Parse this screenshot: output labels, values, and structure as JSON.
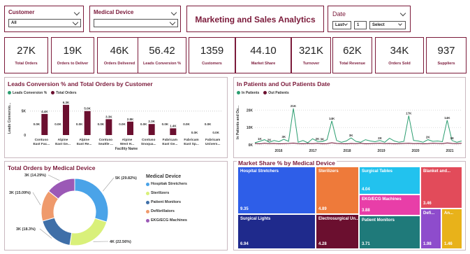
{
  "filters": {
    "customer": {
      "label": "Customer",
      "value": "All"
    },
    "device": {
      "label": "Medical Device",
      "value": ""
    },
    "title": "Marketing and Sales Analytics",
    "date": {
      "label": "Date",
      "mode": "Last",
      "count": "1",
      "unit": "Select"
    }
  },
  "kpis": [
    {
      "value": "27K",
      "label": "Total Orders"
    },
    {
      "value": "19K",
      "label": "Orders to Deliver"
    },
    {
      "value": "46K",
      "label": "Orders Delivered"
    },
    {
      "value": "56.42",
      "label": "Leads Conversion %"
    },
    {
      "value": "1359",
      "label": "Customers"
    },
    {
      "value": "44.10",
      "label": "Market Share"
    },
    {
      "value": "321K",
      "label": "Turnover"
    },
    {
      "value": "62K",
      "label": "Total Revenue"
    },
    {
      "value": "34K",
      "label": "Orders Sold"
    },
    {
      "value": "937",
      "label": "Suppliers"
    }
  ],
  "panels": {
    "leads_title": "Leads Conversion % and Total Orders by Customer",
    "patients_title": "In Patients and Out Patients Date",
    "donut_title": "Total Orders by Medical Device",
    "treemap_title": "Market Share % by Medical Device"
  },
  "colors": {
    "accent": "#7b1a3a",
    "teal": "#2a9d6f",
    "maroon": "#6b0f2f"
  },
  "chart_data": [
    {
      "type": "bar",
      "title": "Leads Conversion % and Total Orders by Customer",
      "legend": [
        "Leads Conversion %",
        "Total Orders"
      ],
      "xlabel": "Facility Name",
      "ylabel": "Leads Conversio...",
      "categories": [
        "Contuso East Fac...",
        "Alpine East Ge...",
        "Alpine East Re...",
        "Contuso Seattle ...",
        "Alpine West H...",
        "Contuso Snoqua...",
        "Fabricam East Ge...",
        "Fabricam East Sp...",
        "Fabricam Univers..."
      ],
      "y_ticks": [
        "0",
        "5K"
      ],
      "ylim": [
        0,
        7000
      ],
      "series": [
        {
          "name": "Leads Conversion %",
          "values": [
            0,
            0,
            0,
            0,
            0,
            0,
            0,
            0,
            0
          ],
          "labels": [
            "0.0K",
            "0.0K",
            "0.0K",
            "0.0K",
            "0.0K",
            "0.0K",
            "0.0K",
            "0.0K",
            "0.0K"
          ]
        },
        {
          "name": "Total Orders",
          "values": [
            4400,
            6300,
            5000,
            3300,
            2800,
            2300,
            1400,
            0,
            0
          ],
          "labels": [
            "4.4K",
            "6.3K",
            "5.0K",
            "3.3K",
            "2.8K",
            "2.3K",
            "1.4K",
            "0.0K",
            "0.0K"
          ]
        }
      ]
    },
    {
      "type": "line",
      "title": "In Patients and Out Patients Date",
      "legend": [
        "In Patients",
        "Out Patients"
      ],
      "ylabel": "In Patients and Ou...",
      "x_ticks": [
        "2016",
        "2017",
        "2018",
        "2019",
        "2020",
        "2021"
      ],
      "y_ticks": [
        "0K",
        "10K",
        "20K"
      ],
      "ylim": [
        0,
        25000
      ],
      "series": [
        {
          "name": "In Patients",
          "values": [
            1200,
            2000,
            3000,
            1500,
            2500,
            1800,
            3200,
            2000,
            21000,
            1500,
            2500,
            1200,
            3500,
            2000,
            1800,
            3000,
            13800,
            2500,
            1500,
            2200,
            4000,
            2000,
            1500,
            3000,
            2200,
            1800,
            2500,
            1500,
            3800,
            2200,
            1500,
            2000,
            16800,
            2500,
            2200,
            1500,
            3000,
            2000,
            2200,
            1800,
            14200,
            2500,
            1500,
            2200
          ]
        },
        {
          "name": "Out Patients",
          "values": [
            800,
            600,
            900,
            700,
            800,
            600,
            700,
            800,
            1000,
            700,
            600,
            800,
            700,
            900,
            600,
            700,
            1200,
            800,
            700,
            600,
            800,
            700,
            900,
            600,
            700,
            800,
            900,
            700,
            800,
            600,
            700,
            800,
            900,
            700,
            800,
            600,
            700,
            900,
            800,
            700,
            1100,
            800,
            700,
            900
          ]
        }
      ],
      "labels": [
        {
          "i": 8,
          "text": "21K"
        },
        {
          "i": 16,
          "text": "14K"
        },
        {
          "i": 32,
          "text": "17K"
        },
        {
          "i": 40,
          "text": "14K"
        },
        {
          "i": 1,
          "text": "1K"
        },
        {
          "i": 3,
          "text": "2K"
        },
        {
          "i": 6,
          "text": "3K"
        },
        {
          "i": 13,
          "text": "2K"
        },
        {
          "i": 14,
          "text": "3K"
        },
        {
          "i": 20,
          "text": "3K"
        },
        {
          "i": 26,
          "text": "2K"
        },
        {
          "i": 36,
          "text": "2K"
        },
        {
          "i": 41,
          "text": "3K"
        }
      ]
    },
    {
      "type": "pie",
      "title": "Total Orders by Medical Device",
      "legend_title": "Medical Device",
      "categories": [
        "Hospital Stretchers",
        "Sterilizers",
        "Patient Monitors",
        "Defibrillators",
        "EKG/ECG Machines"
      ],
      "legend_labels": [
        "Hospitak Stretchers",
        "Sterilizers",
        "Patient Monitors",
        "Defibrillators",
        "EKG/ECG Machines"
      ],
      "values": [
        29.82,
        22.56,
        18.3,
        15.09,
        14.29
      ],
      "labels": [
        "5K (29.82%)",
        "4K (22.56%)",
        "3K (18.3%)",
        "3K (15.09%)",
        "3K (14.29%)"
      ],
      "colors": [
        "#4aa3e8",
        "#d9f07a",
        "#3f6fa8",
        "#ef9a6c",
        "#9b59b6"
      ]
    },
    {
      "type": "treemap",
      "title": "Market Share % by Medical Device",
      "items": [
        {
          "name": "Hospital Stretchers",
          "value": "9.35",
          "color": "#2e5ee8"
        },
        {
          "name": "Surgical Lights",
          "value": "6.94",
          "color": "#1f2a8c"
        },
        {
          "name": "Sterilizers",
          "value": "4.89",
          "color": "#ee7a3a"
        },
        {
          "name": "Electrosurgical Un...",
          "value": "4.28",
          "color": "#6b0f2f"
        },
        {
          "name": "Surgical Tables",
          "value": "4.04",
          "color": "#22c2ee"
        },
        {
          "name": "EKG/ECG Machines",
          "value": "3.88",
          "color": "#e83ea8"
        },
        {
          "name": "Patient Monitors",
          "value": "3.71",
          "color": "#1f7a7a"
        },
        {
          "name": "Blanket and...",
          "value": "3.46",
          "color": "#e24b5a"
        },
        {
          "name": "Defi...",
          "value": "1.98",
          "color": "#8e4ccc"
        },
        {
          "name": "An...",
          "value": "1.46",
          "color": "#e8b21a"
        }
      ]
    }
  ]
}
